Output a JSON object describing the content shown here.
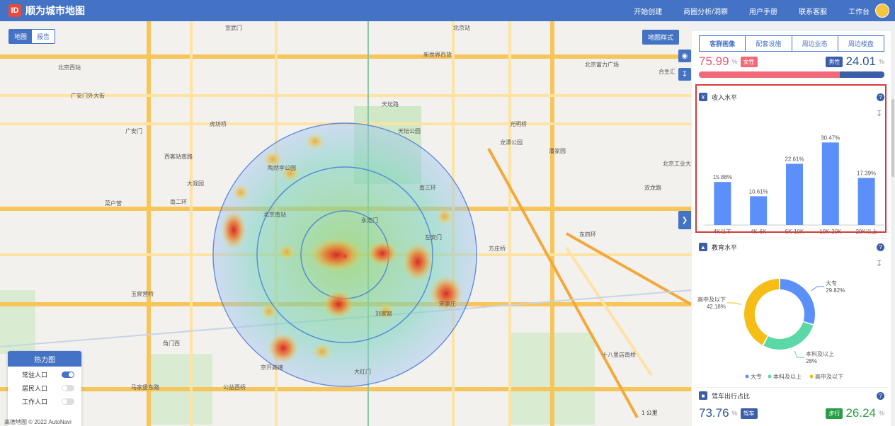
{
  "app": {
    "logo_text": "ID",
    "title": "顺为城市地图"
  },
  "nav": [
    "开始创建",
    "商圈分析/洞察",
    "用户手册",
    "联系客服",
    "工作台"
  ],
  "map_tabs": [
    {
      "label": "地图"
    },
    {
      "label": "报告"
    }
  ],
  "map_style_button": "地图样式",
  "copyright": "高德地图 © 2022 AutoNavi",
  "scale_label": "1 公里",
  "map_labels": [
    {
      "text": "北京站"
    },
    {
      "text": "北京西站"
    },
    {
      "text": "新世界百货"
    },
    {
      "text": "北京富力广场"
    },
    {
      "text": "天坛公园"
    },
    {
      "text": "龙潭公园"
    },
    {
      "text": "陶然亭公园"
    },
    {
      "text": "大观园"
    },
    {
      "text": "北京南站"
    },
    {
      "text": "北京工业大学"
    },
    {
      "text": "合生汇"
    },
    {
      "text": "天坛路"
    },
    {
      "text": "光明桥"
    },
    {
      "text": "潘家园"
    },
    {
      "text": "双龙路"
    },
    {
      "text": "方庄桥"
    },
    {
      "text": "十八里店南桥"
    },
    {
      "text": "南三环"
    },
    {
      "text": "大红门"
    },
    {
      "text": "马家堡东路"
    },
    {
      "text": "公益西桥"
    },
    {
      "text": "广安门外大街"
    },
    {
      "text": "南二环"
    },
    {
      "text": "菜户营"
    },
    {
      "text": "玉泉营桥"
    },
    {
      "text": "东四环"
    },
    {
      "text": "广安门"
    },
    {
      "text": "西客站南路"
    },
    {
      "text": "宣武门"
    },
    {
      "text": "虎坊桥"
    },
    {
      "text": "永定门"
    },
    {
      "text": "左安门"
    },
    {
      "text": "刘家窑"
    },
    {
      "text": "宋家庄"
    },
    {
      "text": "角门西"
    },
    {
      "text": "京开高速"
    }
  ],
  "legend": {
    "title": "热力图",
    "items": [
      {
        "label": "常驻人口",
        "on": true
      },
      {
        "label": "居民人口",
        "on": false
      },
      {
        "label": "工作人口",
        "on": false
      }
    ]
  },
  "panel": {
    "tabs": [
      "客群画像",
      "配套设施",
      "周边业态",
      "周边楼盘"
    ],
    "gender": {
      "female_pct": "75.99",
      "female_label": "女性",
      "male_pct": "24.01",
      "male_label": "男性",
      "pct_sign": "%",
      "female_color": "#f06a7a",
      "male_color": "#3a5ea8"
    },
    "income": {
      "title": "收入水平",
      "help": "?"
    },
    "education": {
      "title": "教育水平",
      "help": "?"
    },
    "travel": {
      "title": "驾车出行占比",
      "help": "?",
      "drive_pct": "73.76",
      "drive_label": "驾车",
      "walk_pct": "26.24",
      "walk_label": "步行",
      "pct_sign": "%"
    }
  },
  "chart_data": [
    {
      "type": "bar",
      "title": "收入水平",
      "categories": [
        "4K以下",
        "4K-6K",
        "6K-10K",
        "10K-20K",
        "20K以上"
      ],
      "values": [
        15.88,
        10.61,
        22.61,
        30.47,
        17.39
      ],
      "labels": [
        "15.88%",
        "10.61%",
        "22.61%",
        "30.47%",
        "17.39%"
      ],
      "ylim": [
        0,
        35
      ],
      "color": "#5b8ff9"
    },
    {
      "type": "pie",
      "title": "教育水平",
      "slices": [
        {
          "name": "大专",
          "value": 29.82,
          "label": "大专",
          "pct_label": "29.82%",
          "color": "#5b8ff9"
        },
        {
          "name": "本科及以上",
          "value": 28.0,
          "label": "本科及以上",
          "pct_label": "28%",
          "color": "#5ad8a6"
        },
        {
          "name": "高中及以下",
          "value": 42.18,
          "label": "高中及以下",
          "pct_label": "42.18%",
          "color": "#f6bd16"
        }
      ],
      "legend": [
        "大专",
        "本科及以上",
        "高中及以下"
      ]
    }
  ]
}
